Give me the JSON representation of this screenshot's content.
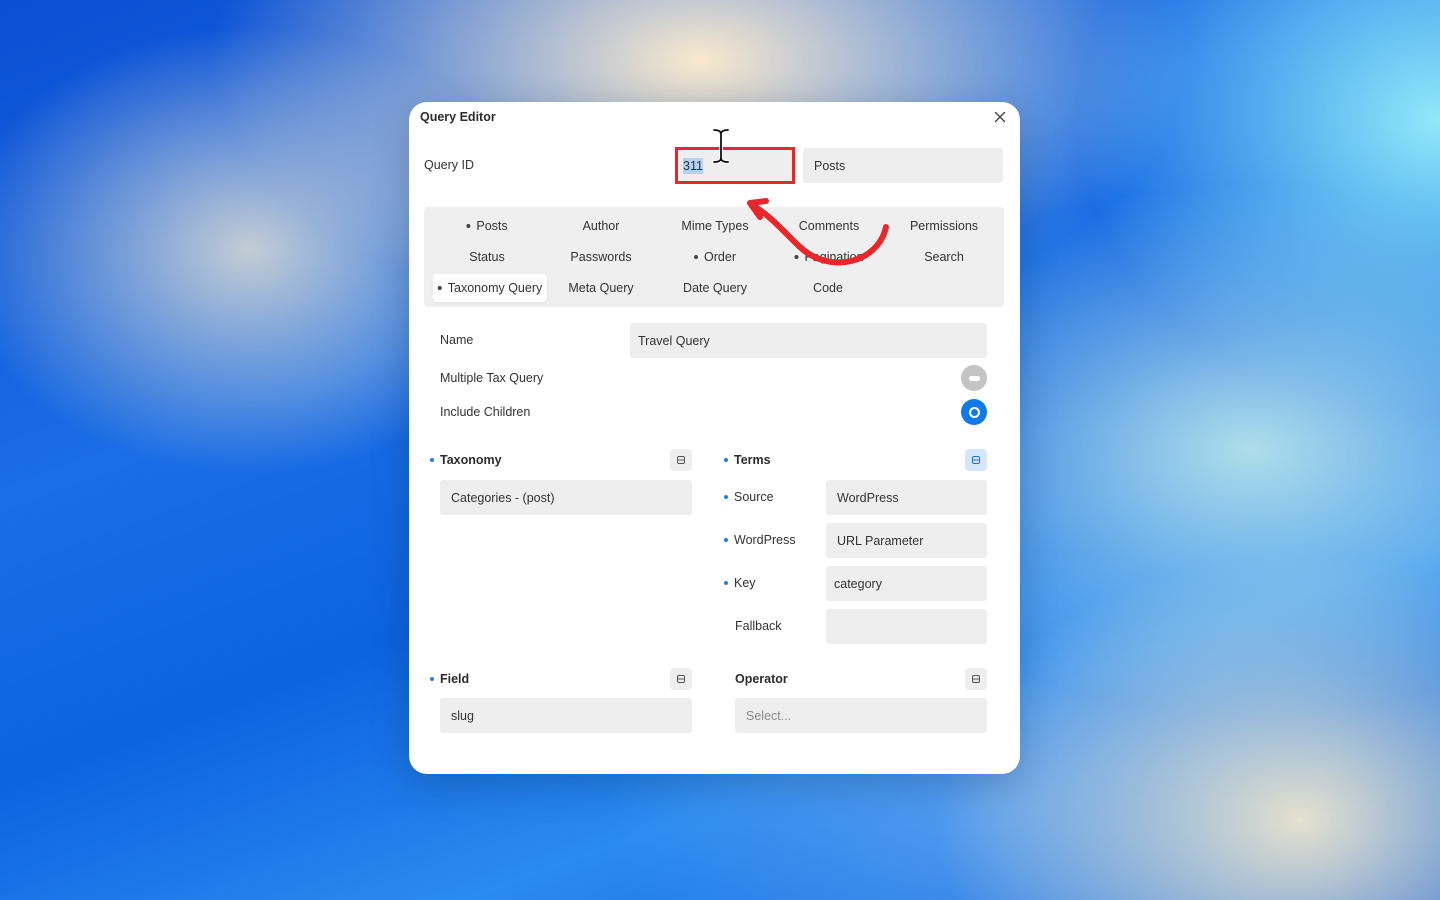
{
  "dialog": {
    "title": "Query Editor",
    "close_icon": "close-icon"
  },
  "query_id": {
    "label": "Query ID",
    "value": "311",
    "type_value": "Posts"
  },
  "tabs": [
    {
      "label": "Posts",
      "dot": true
    },
    {
      "label": "Author",
      "dot": false
    },
    {
      "label": "Mime Types",
      "dot": false
    },
    {
      "label": "Comments",
      "dot": false
    },
    {
      "label": "Permissions",
      "dot": false
    },
    {
      "label": "Status",
      "dot": false
    },
    {
      "label": "Passwords",
      "dot": false
    },
    {
      "label": "Order",
      "dot": true
    },
    {
      "label": "Pagination",
      "dot": true
    },
    {
      "label": "Search",
      "dot": false
    },
    {
      "label": "Taxonomy Query",
      "dot": true,
      "active": true
    },
    {
      "label": "Meta Query",
      "dot": false
    },
    {
      "label": "Date Query",
      "dot": false
    },
    {
      "label": "Code",
      "dot": false
    }
  ],
  "form": {
    "name_label": "Name",
    "name_value": "Travel Query",
    "multiple_tax_label": "Multiple Tax Query",
    "multiple_tax_on": false,
    "include_children_label": "Include Children",
    "include_children_on": true
  },
  "taxonomy": {
    "title": "Taxonomy",
    "value": "Categories - (post)"
  },
  "terms": {
    "title": "Terms",
    "source_label": "Source",
    "source_value": "WordPress",
    "wordpress_label": "WordPress",
    "wordpress_value": "URL Parameter",
    "key_label": "Key",
    "key_value": "category",
    "fallback_label": "Fallback",
    "fallback_value": ""
  },
  "field": {
    "title": "Field",
    "value": "slug"
  },
  "operator": {
    "title": "Operator",
    "placeholder": "Select..."
  },
  "colors": {
    "accent": "#1279ea",
    "annotation": "#e8262b",
    "selection": "#b4d0f5"
  }
}
